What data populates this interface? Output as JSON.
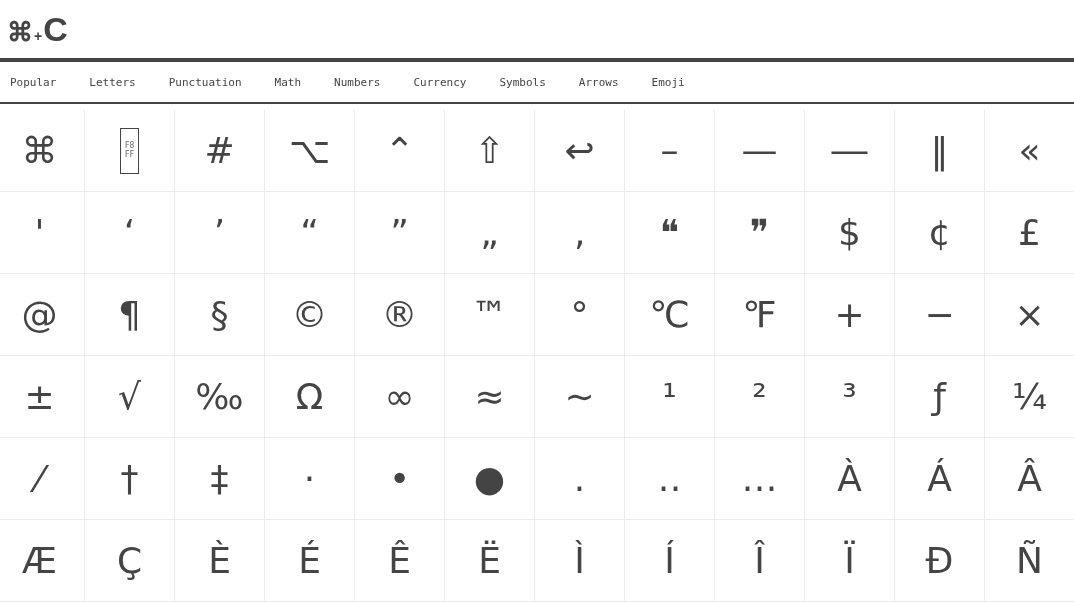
{
  "logo": {
    "parts": [
      "⌘",
      "+",
      "C"
    ]
  },
  "nav": [
    "Popular",
    "Letters",
    "Punctuation",
    "Math",
    "Numbers",
    "Currency",
    "Symbols",
    "Arrows",
    "Emoji"
  ],
  "rows": [
    [
      "⌘",
      {
        "kind": "missing",
        "text": "F8FF"
      },
      "#",
      "⌥",
      "⌃",
      "⇧",
      "↩",
      "–",
      "—",
      "―",
      "‖",
      "«"
    ],
    [
      "'",
      "‘",
      "’",
      "“",
      "”",
      "„",
      "‚",
      "❝",
      "❞",
      "$",
      "¢",
      "£"
    ],
    [
      "@",
      "¶",
      "§",
      "©",
      "®",
      "™",
      "°",
      "℃",
      "℉",
      "+",
      "−",
      "×"
    ],
    [
      "±",
      "√",
      "‰",
      "Ω",
      "∞",
      "≈",
      "∼",
      "¹",
      "²",
      "³",
      "ƒ",
      "¼"
    ],
    [
      "⁄",
      "†",
      "‡",
      "·",
      "•",
      "●",
      ".",
      "‥",
      "…",
      "À",
      "Á",
      "Â"
    ],
    [
      "Æ",
      "Ç",
      "È",
      "É",
      "Ê",
      "Ë",
      "Ì",
      "Í",
      "Î",
      "Ï",
      "Ð",
      "Ñ"
    ]
  ]
}
